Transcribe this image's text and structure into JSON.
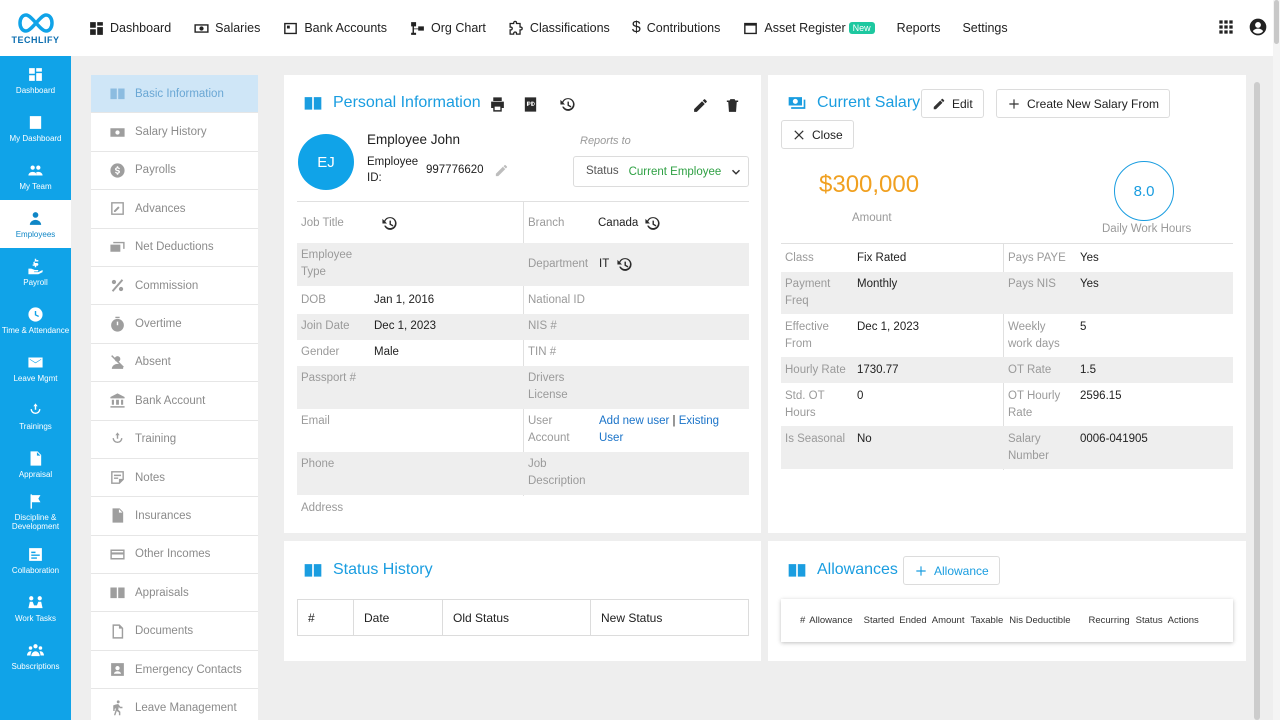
{
  "app": {
    "logo_text": "TECHLIFY"
  },
  "topnav": [
    {
      "label": "Dashboard",
      "icon": "dashboard-icon"
    },
    {
      "label": "Salaries",
      "icon": "money-icon"
    },
    {
      "label": "Bank Accounts",
      "icon": "bank-icon"
    },
    {
      "label": "Org Chart",
      "icon": "org-chart-icon"
    },
    {
      "label": "Classifications",
      "icon": "puzzle-icon"
    },
    {
      "label": "Contributions",
      "icon": "dollar-icon"
    },
    {
      "label": "Asset Register",
      "icon": "asset-icon",
      "badge": "New"
    },
    {
      "label": "Reports"
    },
    {
      "label": "Settings"
    }
  ],
  "sidebar": [
    {
      "label": "Dashboard"
    },
    {
      "label": "My Dashboard"
    },
    {
      "label": "My Team"
    },
    {
      "label": "Employees",
      "active": true
    },
    {
      "label": "Payroll"
    },
    {
      "label": "Time & Attendance"
    },
    {
      "label": "Leave Mgmt"
    },
    {
      "label": "Trainings"
    },
    {
      "label": "Appraisal"
    },
    {
      "label": "Discipline & Development"
    },
    {
      "label": "Collaboration"
    },
    {
      "label": "Work Tasks"
    },
    {
      "label": "Subscriptions"
    }
  ],
  "subnav": [
    "Basic Information",
    "Salary History",
    "Payrolls",
    "Advances",
    "Net Deductions",
    "Commission",
    "Overtime",
    "Absent",
    "Bank Account",
    "Training",
    "Notes",
    "Insurances",
    "Other Incomes",
    "Appraisals",
    "Documents",
    "Emergency Contacts",
    "Leave Management"
  ],
  "personal": {
    "title": "Personal Information",
    "initials": "EJ",
    "name": "Employee John",
    "employee_id_label_1": "Employee",
    "employee_id_label_2": "ID:",
    "employee_id": "997776620",
    "reports_to": "Reports to",
    "status_label": "Status",
    "status_value": "Current Employee",
    "fields": {
      "job_title": "Job Title",
      "branch_label": "Branch",
      "branch": "Canada",
      "emp_type_1": "Employee",
      "emp_type_2": "Type",
      "department_label": "Department",
      "department": "IT",
      "dob_label": "DOB",
      "dob": "Jan 1, 2016",
      "national_id": "National ID",
      "join_label": "Join Date",
      "join": "Dec 1, 2023",
      "nis": "NIS #",
      "gender_label": "Gender",
      "gender": "Male",
      "tin": "TIN #",
      "passport": "Passport #",
      "drivers_1": "Drivers",
      "drivers_2": "License",
      "email": "Email",
      "user_acct_1": "User",
      "user_acct_2": "Account",
      "add_new_user": "Add new user",
      "sep": " | ",
      "existing_1": "Existing",
      "existing_2": "User",
      "phone": "Phone",
      "job_desc_1": "Job",
      "job_desc_2": "Description",
      "address": "Address"
    }
  },
  "salary": {
    "title": "Current Salary",
    "edit": "Edit",
    "create_new": "Create New Salary From",
    "close": "Close",
    "amount": "$300,000",
    "amount_label": "Amount",
    "hours": "8.0",
    "hours_label": "Daily Work Hours",
    "rows": [
      {
        "l1": "Class",
        "v1": "Fix Rated",
        "l2": "Pays PAYE",
        "v2": "Yes"
      },
      {
        "l1": "Payment Freq",
        "v1": "Monthly",
        "l2": "Pays NIS",
        "v2": "Yes"
      },
      {
        "l1": "Effective From",
        "v1": "Dec 1, 2023",
        "l2": "Weekly work days",
        "v2": "5"
      },
      {
        "l1": "Hourly Rate",
        "v1": "1730.77",
        "l2": "OT Rate",
        "v2": "1.5"
      },
      {
        "l1": "Std. OT Hours",
        "v1": "0",
        "l2": "OT Hourly Rate",
        "v2": "2596.15"
      },
      {
        "l1": "Is Seasonal",
        "v1": "No",
        "l2": "Salary Number",
        "v2": "0006-041905"
      }
    ]
  },
  "status_history": {
    "title": "Status History",
    "columns": [
      "#",
      "Date",
      "Old Status",
      "New Status"
    ]
  },
  "allowances": {
    "title": "Allowances",
    "add_button": "Allowance",
    "columns": [
      "#",
      "Allowance",
      "Started",
      "Ended",
      "Amount",
      "Taxable",
      "Nis Deductible",
      "Recurring",
      "Status",
      "Actions"
    ]
  }
}
